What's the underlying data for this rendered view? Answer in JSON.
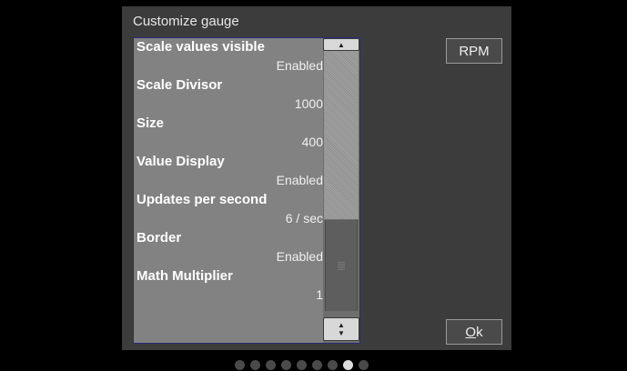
{
  "dialog": {
    "title": "Customize gauge",
    "items": [
      {
        "label": "Scale values visible",
        "value": "Enabled"
      },
      {
        "label": "Scale Divisor",
        "value": "1000"
      },
      {
        "label": "Size",
        "value": "400"
      },
      {
        "label": "Value Display",
        "value": "Enabled"
      },
      {
        "label": "Updates per second",
        "value": "6 / sec"
      },
      {
        "label": "Border",
        "value": "Enabled"
      },
      {
        "label": "Math Multiplier",
        "value": "1"
      }
    ],
    "gauge_button": "RPM",
    "ok_button": {
      "accel": "O",
      "rest": "k"
    }
  },
  "pager": {
    "count": 9,
    "active_index": 7
  },
  "colors": {
    "list_bg": "#828282",
    "dialog_bg": "#3c3c3c",
    "list_border": "#2a2a7a"
  }
}
